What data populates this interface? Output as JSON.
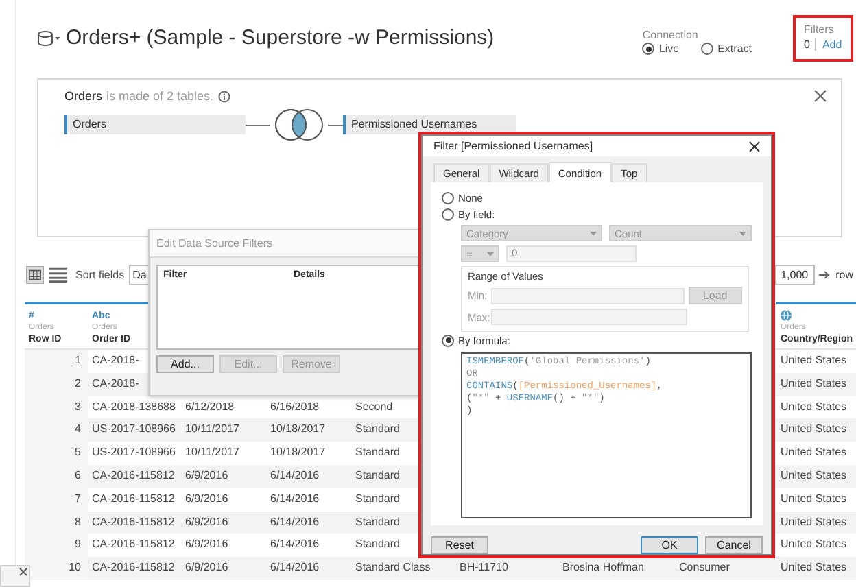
{
  "header": {
    "title": "Orders+ (Sample - Superstore -w Permissions)",
    "connection": {
      "label": "Connection",
      "options": [
        {
          "label": "Live",
          "selected": true
        },
        {
          "label": "Extract",
          "selected": false
        }
      ]
    },
    "filters": {
      "label": "Filters",
      "count": "0",
      "add": "Add",
      "highlighted": true
    }
  },
  "join_panel": {
    "table_name": "Orders",
    "description": "is made of 2 tables.",
    "tables": [
      "Orders",
      "Permissioned Usernames"
    ]
  },
  "toolbar": {
    "sort_label": "Sort fields",
    "sort_value": "Da",
    "row_limit": "1,000",
    "rows_label": "row"
  },
  "table": {
    "columns": {
      "row_id": {
        "kind": "number",
        "type_label": "#",
        "source": "Orders",
        "name": "Row ID"
      },
      "order_id": {
        "kind": "text",
        "type_label": "Abc",
        "source": "Orders",
        "name": "Order ID"
      },
      "country_region": {
        "kind": "geo",
        "source": "Orders",
        "name": "Country/Region"
      }
    },
    "rows": [
      {
        "row_id": "1",
        "order_id": "CA-2018-",
        "country_region": "United States"
      },
      {
        "row_id": "2",
        "order_id": "CA-2018-",
        "country_region": "United States"
      },
      {
        "row_id": "3",
        "order_id": "CA-2018-138688",
        "column_3": "6/12/2018",
        "column_4": "6/16/2018",
        "column_5": "Second",
        "country_region": "United States"
      },
      {
        "row_id": "4",
        "order_id": "US-2017-108966",
        "column_3": "10/11/2017",
        "column_4": "10/18/2017",
        "column_5": "Standard",
        "country_region": "United States"
      },
      {
        "row_id": "5",
        "order_id": "US-2017-108966",
        "column_3": "10/11/2017",
        "column_4": "10/18/2017",
        "column_5": "Standard",
        "country_region": "United States"
      },
      {
        "row_id": "6",
        "order_id": "CA-2016-115812",
        "column_3": "6/9/2016",
        "column_4": "6/14/2016",
        "column_5": "Standard",
        "country_region": "United States"
      },
      {
        "row_id": "7",
        "order_id": "CA-2016-115812",
        "column_3": "6/9/2016",
        "column_4": "6/14/2016",
        "column_5": "Standard",
        "country_region": "United States"
      },
      {
        "row_id": "8",
        "order_id": "CA-2016-115812",
        "column_3": "6/9/2016",
        "column_4": "6/14/2016",
        "column_5": "Standard",
        "country_region": "United States"
      },
      {
        "row_id": "9",
        "order_id": "CA-2016-115812",
        "column_3": "6/9/2016",
        "column_4": "6/14/2016",
        "column_5": "Standard",
        "country_region": "United States"
      },
      {
        "row_id": "10",
        "order_id": "CA-2016-115812",
        "column_3": "6/9/2016",
        "column_4": "6/14/2016",
        "column_5": "Standard Class",
        "column_6": "BH-11710",
        "column_7": "Brosina Hoffman",
        "column_8": "Consumer",
        "country_region": "United States"
      }
    ]
  },
  "edit_filters_dialog": {
    "title": "Edit Data Source Filters",
    "columns": [
      "Filter",
      "Details"
    ],
    "buttons": [
      {
        "label": "Add...",
        "disabled": false
      },
      {
        "label": "Edit...",
        "disabled": true
      },
      {
        "label": "Remove",
        "disabled": true
      }
    ]
  },
  "filter_dialog": {
    "title": "Filter [Permissioned Usernames]",
    "highlighted": true,
    "tabs": [
      {
        "label": "General",
        "selected": false
      },
      {
        "label": "Wildcard",
        "selected": false
      },
      {
        "label": "Condition",
        "selected": true
      },
      {
        "label": "Top",
        "selected": false
      }
    ],
    "options": [
      {
        "kind": "none",
        "label": "None",
        "selected": false
      },
      {
        "kind": "field",
        "label": "By field:",
        "selected": false
      },
      {
        "kind": "formula",
        "label": "By formula:",
        "selected": true
      }
    ],
    "by_field": {
      "field": "Category",
      "aggregation": "Count",
      "operator": "=",
      "value": "0",
      "range_title": "Range of Values",
      "min_label": "Min:",
      "max_label": "Max:",
      "load": "Load"
    },
    "formula": [
      [
        {
          "kind": "function",
          "text": "ISMEMBEROF"
        },
        {
          "kind": "plain",
          "text": "("
        },
        {
          "kind": "string",
          "text": "'Global Permissions'"
        },
        {
          "kind": "plain",
          "text": ")"
        }
      ],
      [
        {
          "kind": "keyword",
          "text": "OR"
        }
      ],
      [
        {
          "kind": "function",
          "text": "CONTAINS"
        },
        {
          "kind": "plain",
          "text": "("
        },
        {
          "kind": "field",
          "text": "[Permissioned_Usernames]"
        },
        {
          "kind": "plain",
          "text": ","
        }
      ],
      [
        {
          "kind": "plain",
          "text": "("
        },
        {
          "kind": "string",
          "text": "\"*\""
        },
        {
          "kind": "plain",
          "text": " + "
        },
        {
          "kind": "function",
          "text": "USERNAME"
        },
        {
          "kind": "plain",
          "text": "() + "
        },
        {
          "kind": "string",
          "text": "\"*\""
        },
        {
          "kind": "plain",
          "text": ")"
        }
      ],
      [
        {
          "kind": "plain",
          "text": ")"
        }
      ]
    ],
    "buttons": {
      "reset": "Reset",
      "ok": "OK",
      "cancel": "Cancel"
    }
  }
}
